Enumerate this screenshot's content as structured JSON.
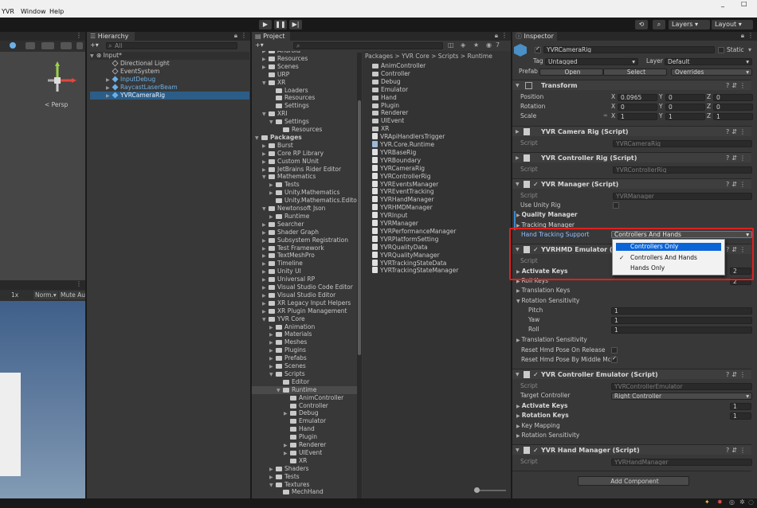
{
  "menu": [
    "YVR",
    "Window",
    "Help"
  ],
  "window_controls": [
    "_",
    "□"
  ],
  "toolbar": {
    "play": "▶",
    "pause": "❚❚",
    "step": "▶|",
    "layers": "Layers",
    "layout": "Layout"
  },
  "scene_view": {
    "persp_label": "< Persp",
    "speed": "1x",
    "normal": "Norm.",
    "mute": "Mute Aud"
  },
  "hierarchy": {
    "tab": "Hierarchy",
    "search_placeholder": "All",
    "scene": "Input*",
    "items": [
      {
        "label": "Directional Light",
        "type": "go",
        "depth": 2,
        "blue": false
      },
      {
        "label": "EventSystem",
        "type": "go",
        "depth": 2,
        "blue": false
      },
      {
        "label": "InputDebug",
        "type": "prefab",
        "depth": 2,
        "blue": true
      },
      {
        "label": "RaycastLaserBeam",
        "type": "prefab",
        "depth": 2,
        "blue": true
      },
      {
        "label": "YVRCameraRig",
        "type": "prefab",
        "depth": 2,
        "blue": true
      }
    ]
  },
  "project": {
    "tab": "Project",
    "count": "7",
    "breadcrumb": "Packages > YVR Core > Scripts > Runtime",
    "tree": [
      {
        "label": "Android",
        "d": 1,
        "fold": "▶"
      },
      {
        "label": "Resources",
        "d": 1,
        "fold": "▶"
      },
      {
        "label": "Scenes",
        "d": 1,
        "fold": "▶"
      },
      {
        "label": "URP",
        "d": 1,
        "fold": ""
      },
      {
        "label": "XR",
        "d": 1,
        "fold": "▼"
      },
      {
        "label": "Loaders",
        "d": 2,
        "fold": ""
      },
      {
        "label": "Resources",
        "d": 2,
        "fold": ""
      },
      {
        "label": "Settings",
        "d": 2,
        "fold": ""
      },
      {
        "label": "XRI",
        "d": 1,
        "fold": "▼"
      },
      {
        "label": "Settings",
        "d": 2,
        "fold": "▼"
      },
      {
        "label": "Resources",
        "d": 3,
        "fold": ""
      },
      {
        "label": "Packages",
        "d": 0,
        "fold": "▼",
        "bold": true
      },
      {
        "label": "Burst",
        "d": 1,
        "fold": "▶"
      },
      {
        "label": "Core RP Library",
        "d": 1,
        "fold": "▶"
      },
      {
        "label": "Custom NUnit",
        "d": 1,
        "fold": "▶"
      },
      {
        "label": "JetBrains Rider Editor",
        "d": 1,
        "fold": "▶"
      },
      {
        "label": "Mathematics",
        "d": 1,
        "fold": "▼"
      },
      {
        "label": "Tests",
        "d": 2,
        "fold": "▶"
      },
      {
        "label": "Unity.Mathematics",
        "d": 2,
        "fold": "▶"
      },
      {
        "label": "Unity.Mathematics.Editor",
        "d": 2,
        "fold": ""
      },
      {
        "label": "Newtonsoft Json",
        "d": 1,
        "fold": "▼"
      },
      {
        "label": "Runtime",
        "d": 2,
        "fold": "▶"
      },
      {
        "label": "Searcher",
        "d": 1,
        "fold": "▶"
      },
      {
        "label": "Shader Graph",
        "d": 1,
        "fold": "▶"
      },
      {
        "label": "Subsystem Registration",
        "d": 1,
        "fold": "▶"
      },
      {
        "label": "Test Framework",
        "d": 1,
        "fold": "▶"
      },
      {
        "label": "TextMeshPro",
        "d": 1,
        "fold": "▶"
      },
      {
        "label": "Timeline",
        "d": 1,
        "fold": "▶"
      },
      {
        "label": "Unity UI",
        "d": 1,
        "fold": "▶"
      },
      {
        "label": "Universal RP",
        "d": 1,
        "fold": "▶"
      },
      {
        "label": "Visual Studio Code Editor",
        "d": 1,
        "fold": "▶"
      },
      {
        "label": "Visual Studio Editor",
        "d": 1,
        "fold": "▶"
      },
      {
        "label": "XR Legacy Input Helpers",
        "d": 1,
        "fold": "▶"
      },
      {
        "label": "XR Plugin Management",
        "d": 1,
        "fold": "▶"
      },
      {
        "label": "YVR Core",
        "d": 1,
        "fold": "▼"
      },
      {
        "label": "Animation",
        "d": 2,
        "fold": "▶"
      },
      {
        "label": "Materials",
        "d": 2,
        "fold": "▶"
      },
      {
        "label": "Meshes",
        "d": 2,
        "fold": "▶"
      },
      {
        "label": "Plugins",
        "d": 2,
        "fold": "▶"
      },
      {
        "label": "Prefabs",
        "d": 2,
        "fold": "▶"
      },
      {
        "label": "Scenes",
        "d": 2,
        "fold": "▶"
      },
      {
        "label": "Scripts",
        "d": 2,
        "fold": "▼"
      },
      {
        "label": "Editor",
        "d": 3,
        "fold": ""
      },
      {
        "label": "Runtime",
        "d": 3,
        "fold": "▼",
        "selected": true
      },
      {
        "label": "AnimController",
        "d": 4,
        "fold": ""
      },
      {
        "label": "Controller",
        "d": 4,
        "fold": ""
      },
      {
        "label": "Debug",
        "d": 4,
        "fold": "▶"
      },
      {
        "label": "Emulator",
        "d": 4,
        "fold": ""
      },
      {
        "label": "Hand",
        "d": 4,
        "fold": ""
      },
      {
        "label": "Plugin",
        "d": 4,
        "fold": ""
      },
      {
        "label": "Renderer",
        "d": 4,
        "fold": "▶"
      },
      {
        "label": "UIEvent",
        "d": 4,
        "fold": "▶"
      },
      {
        "label": "XR",
        "d": 4,
        "fold": ""
      },
      {
        "label": "Shaders",
        "d": 2,
        "fold": "▶"
      },
      {
        "label": "Tests",
        "d": 2,
        "fold": "▶"
      },
      {
        "label": "Textures",
        "d": 2,
        "fold": "▼"
      },
      {
        "label": "MechHand",
        "d": 3,
        "fold": ""
      }
    ],
    "files": [
      {
        "label": "AnimController",
        "kind": "folder"
      },
      {
        "label": "Controller",
        "kind": "folder"
      },
      {
        "label": "Debug",
        "kind": "folder"
      },
      {
        "label": "Emulator",
        "kind": "folder"
      },
      {
        "label": "Hand",
        "kind": "folder"
      },
      {
        "label": "Plugin",
        "kind": "folder"
      },
      {
        "label": "Renderer",
        "kind": "folder"
      },
      {
        "label": "UIEvent",
        "kind": "folder"
      },
      {
        "label": "XR",
        "kind": "folder"
      },
      {
        "label": "VRApiHandlersTrigger",
        "kind": "script"
      },
      {
        "label": "YVR.Core.Runtime",
        "kind": "asmdef"
      },
      {
        "label": "YVRBaseRig",
        "kind": "script"
      },
      {
        "label": "YVRBoundary",
        "kind": "script"
      },
      {
        "label": "YVRCameraRig",
        "kind": "script"
      },
      {
        "label": "YVRControllerRig",
        "kind": "script"
      },
      {
        "label": "YVREventsManager",
        "kind": "script"
      },
      {
        "label": "YVREventTracking",
        "kind": "script"
      },
      {
        "label": "YVRHandManager",
        "kind": "script"
      },
      {
        "label": "YVRHMDManager",
        "kind": "script"
      },
      {
        "label": "YVRInput",
        "kind": "script"
      },
      {
        "label": "YVRManager",
        "kind": "script"
      },
      {
        "label": "YVRPerformanceManager",
        "kind": "script"
      },
      {
        "label": "YVRPlatformSetting",
        "kind": "script"
      },
      {
        "label": "YVRQualityData",
        "kind": "script"
      },
      {
        "label": "YVRQualityManager",
        "kind": "script"
      },
      {
        "label": "YVRTrackingStateData",
        "kind": "script"
      },
      {
        "label": "YVRTrackingStateManager",
        "kind": "script"
      }
    ]
  },
  "inspector": {
    "tab": "Inspector",
    "object_name": "YVRCameraRig",
    "static_label": "Static",
    "tag_label": "Tag",
    "tag_value": "Untagged",
    "layer_label": "Layer",
    "layer_value": "Default",
    "prefab_label": "Prefab",
    "prefab_open": "Open",
    "prefab_select": "Select",
    "prefab_overrides": "Overrides",
    "transform": {
      "title": "Transform",
      "position_label": "Position",
      "position": [
        "0.0965",
        "0",
        "0"
      ],
      "rotation_label": "Rotation",
      "rotation": [
        "0",
        "0",
        "0"
      ],
      "scale_label": "Scale",
      "scale": [
        "1",
        "1",
        "1"
      ],
      "axes": [
        "X",
        "Y",
        "Z"
      ]
    },
    "script_label": "Script",
    "camera_rig": {
      "title": "YVR Camera Rig (Script)",
      "script": "YVRCameraRig"
    },
    "controller_rig": {
      "title": "YVR Controller Rig (Script)",
      "script": "YVRControllerRig"
    },
    "manager": {
      "title": "YVR Manager (Script)",
      "script": "YVRManager",
      "use_unity_rig": "Use Unity Rig",
      "quality_manager": "Quality Manager",
      "tracking_manager": "Tracking Manager",
      "hand_tracking_label": "Hand Tracking Support",
      "hand_tracking_value": "Controllers And Hands"
    },
    "dropdown_options": [
      {
        "label": "Controllers Only",
        "highlighted": true,
        "checked": false
      },
      {
        "label": "Controllers And Hands",
        "highlighted": false,
        "checked": true
      },
      {
        "label": "Hands Only",
        "highlighted": false,
        "checked": false
      }
    ],
    "hmd_emulator": {
      "title": "YVRHMD Emulator (Scri",
      "activate_keys": "Activate Keys",
      "activate_keys_value": "2",
      "roll_keys": "Roll Keys",
      "roll_keys_value": "2",
      "translation_keys": "Translation Keys",
      "rotation_sensitivity": "Rotation Sensitivity",
      "pitch": "Pitch",
      "pitch_value": "1",
      "yaw": "Yaw",
      "yaw_value": "1",
      "roll": "Roll",
      "roll_value": "1",
      "translation_sensitivity": "Translation Sensitivity",
      "reset_release": "Reset Hmd Pose On Release",
      "reset_middle": "Reset Hmd Pose By Middle Mou"
    },
    "controller_emulator": {
      "title": "YVR Controller Emulator (Script)",
      "script": "YVRControllerEmulator",
      "target_label": "Target Controller",
      "target_value": "Right Controller",
      "activate_keys": "Activate Keys",
      "activate_keys_value": "1",
      "rotation_keys": "Rotation Keys",
      "rotation_keys_value": "1",
      "key_mapping": "Key Mapping",
      "rotation_sensitivity": "Rotation Sensitivity"
    },
    "hand_manager": {
      "title": "YVR Hand Manager (Script)",
      "script": "YVRHandManager"
    },
    "add_component": "Add Component"
  },
  "colors": {
    "highlight_red": "#e02020",
    "selection_blue": "#2c5d87",
    "dropdown_highlight": "#0a64d8",
    "prefab_blue": "#6ab0e8"
  }
}
